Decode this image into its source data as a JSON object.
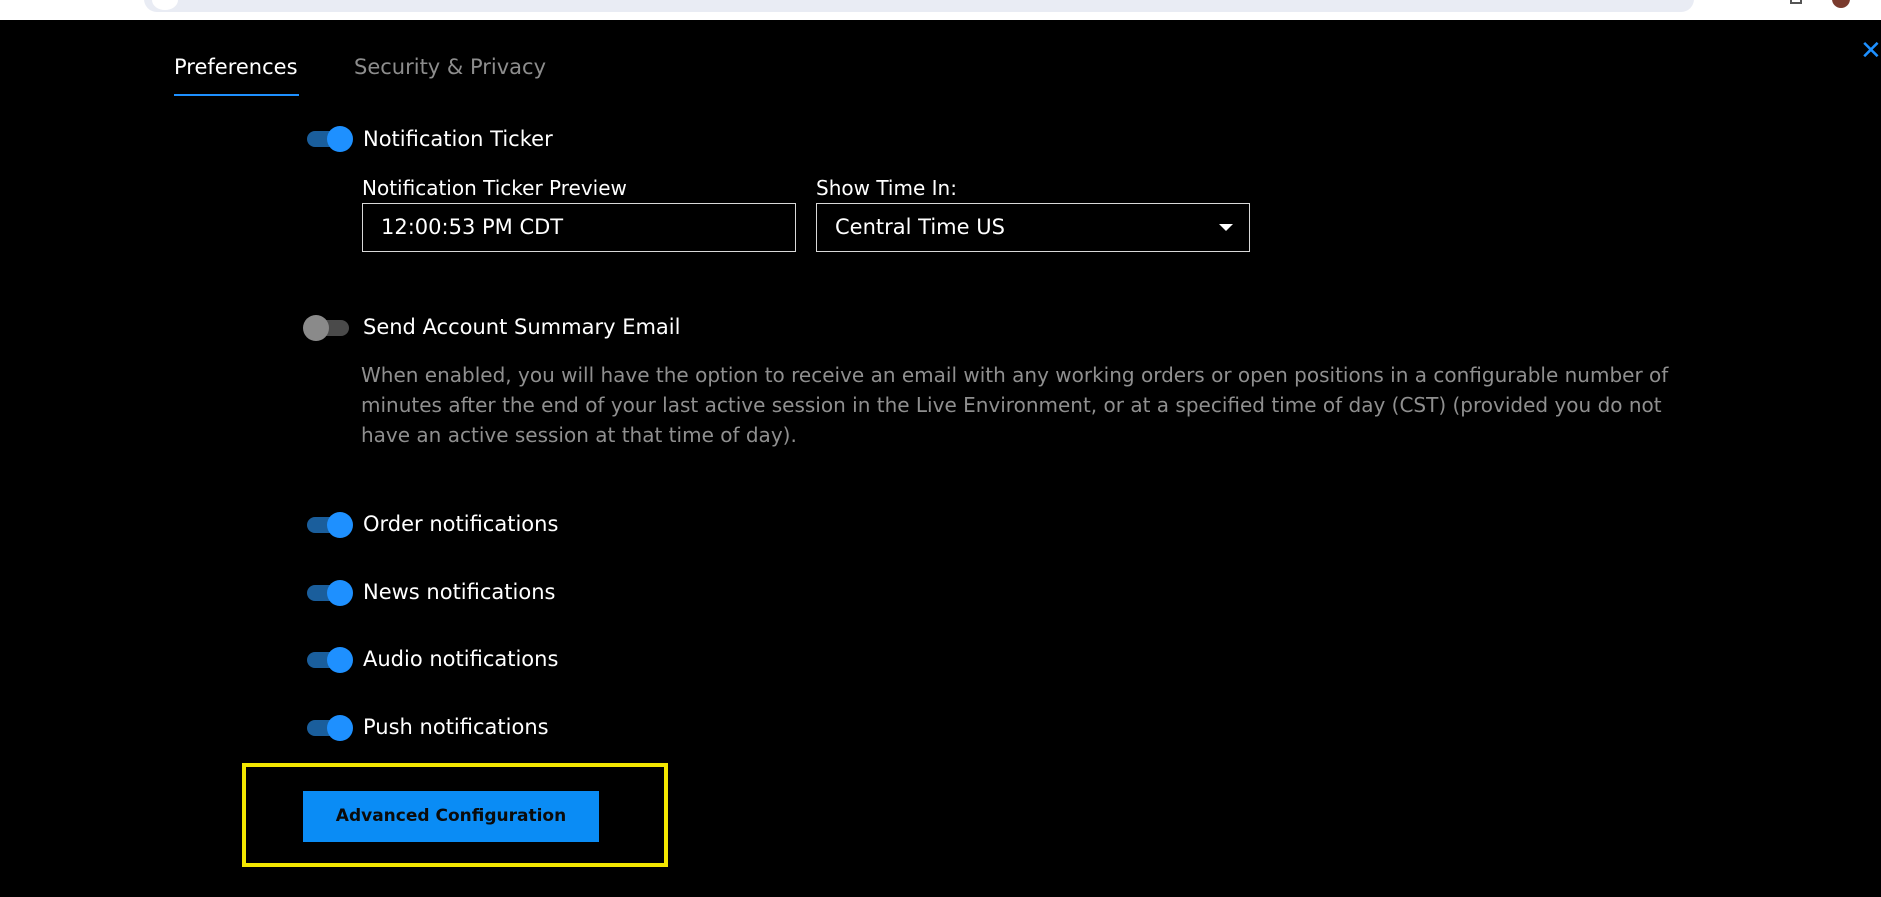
{
  "tabs": [
    {
      "label": "Preferences",
      "active": true
    },
    {
      "label": "Security & Privacy",
      "active": false
    }
  ],
  "notification_ticker": {
    "label": "Notification Ticker",
    "enabled": true,
    "preview_label": "Notification Ticker Preview",
    "preview_value": "12:00:53 PM CDT",
    "timezone_label": "Show Time In:",
    "timezone_value": "Central Time US"
  },
  "account_summary": {
    "label": "Send Account Summary Email",
    "enabled": false,
    "description": "When enabled, you will have the option to receive an email with any working orders or open positions in a configurable number of minutes after the end of your last active session in the Live Environment, or at a specified time of day (CST) (provided you do not have an active session at that time of day)."
  },
  "notifications": [
    {
      "label": "Order notifications",
      "enabled": true
    },
    {
      "label": "News notifications",
      "enabled": true
    },
    {
      "label": "Audio notifications",
      "enabled": true
    },
    {
      "label": "Push notifications",
      "enabled": true
    }
  ],
  "advanced_button": {
    "label": "Advanced Configuration"
  },
  "icons": {
    "close": "close-icon",
    "dropdown": "chevron-down-icon"
  },
  "colors": {
    "accent": "#1e90ff",
    "highlight": "#f2e600",
    "background": "#000000"
  }
}
